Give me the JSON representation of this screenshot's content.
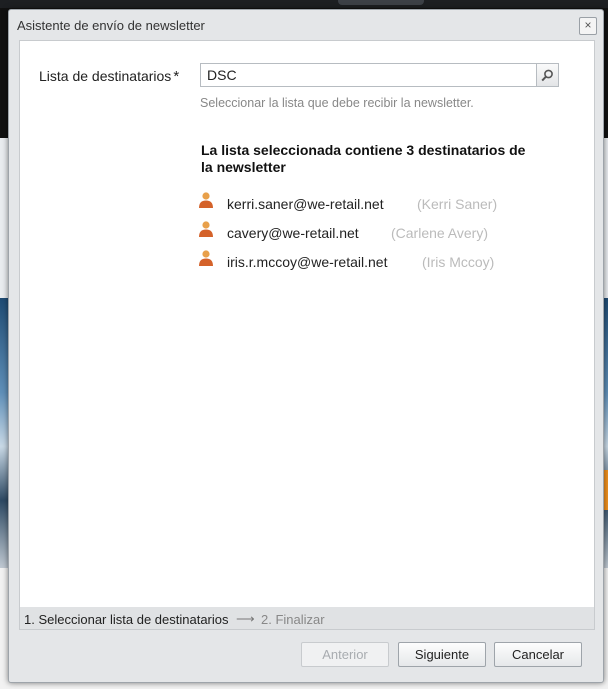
{
  "dialog": {
    "title": "Asistente de envío de newsletter",
    "close_glyph": "×"
  },
  "form": {
    "list_label": "Lista de destinatarios",
    "required_mark": "*",
    "list_value": "DSC",
    "hint": "Seleccionar la lista que debe recibir la newsletter.",
    "heading": "La lista seleccionada contiene 3 destinatarios de la newsletter"
  },
  "recipients": [
    {
      "email": "kerri.saner@we-retail.net",
      "name": "(Kerri Saner)",
      "icon": "user-icon"
    },
    {
      "email": "cavery@we-retail.net",
      "name": "(Carlene Avery)",
      "icon": "user-icon"
    },
    {
      "email": "iris.r.mccoy@we-retail.net",
      "name": "(Iris Mccoy)",
      "icon": "user-icon"
    }
  ],
  "steps": {
    "step1": "1. Seleccionar lista de destinatarios",
    "arrow": "⟶",
    "step2": "2. Finalizar"
  },
  "buttons": {
    "prev": "Anterior",
    "next": "Siguiente",
    "cancel": "Cancelar"
  },
  "colors": {
    "user_icon_body": "#d4622a",
    "user_icon_head": "#e8a04a"
  }
}
